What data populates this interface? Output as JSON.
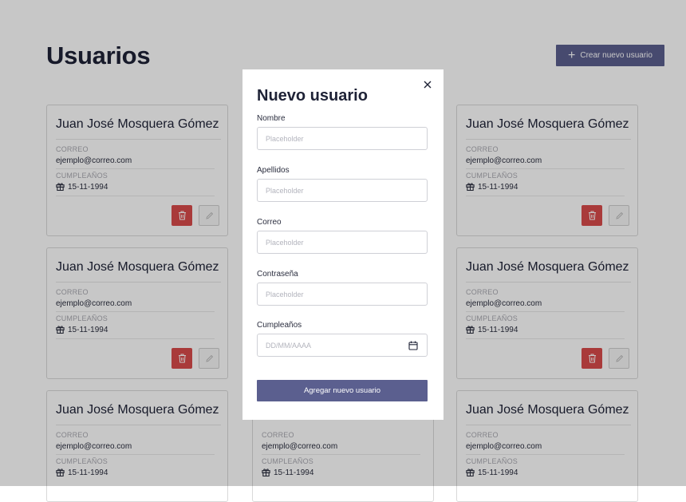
{
  "page": {
    "title": "Usuarios",
    "create_button_label": "Crear nuevo usuario"
  },
  "users": [
    {
      "name": "Juan José Mosquera Gómez",
      "email_label": "CORREO",
      "email": "ejemplo@correo.com",
      "birthday_label": "CUMPLEAÑOS",
      "birthday": "15-11-1994"
    },
    {
      "name": "Juan José Mosquera Gómez",
      "email_label": "CORREO",
      "email": "ejemplo@correo.com",
      "birthday_label": "CUMPLEAÑOS",
      "birthday": "15-11-1994"
    },
    {
      "name": "Juan José Mosquera Gómez",
      "email_label": "CORREO",
      "email": "ejemplo@correo.com",
      "birthday_label": "CUMPLEAÑOS",
      "birthday": "15-11-1994"
    },
    {
      "name": "Juan José Mosquera Gómez",
      "email_label": "CORREO",
      "email": "ejemplo@correo.com",
      "birthday_label": "CUMPLEAÑOS",
      "birthday": "15-11-1994"
    },
    {
      "name": "Juan José Mosquera Gómez",
      "email_label": "CORREO",
      "email": "ejemplo@correo.com",
      "birthday_label": "CUMPLEAÑOS",
      "birthday": "15-11-1994"
    },
    {
      "name": "",
      "email_label": "CORREO",
      "email": "ejemplo@correo.com",
      "birthday_label": "CUMPLEAÑOS",
      "birthday": "15-11-1994"
    },
    {
      "name": "Juan José Mosquera Gómez",
      "email_label": "CORREO",
      "email": "ejemplo@correo.com",
      "birthday_label": "CUMPLEAÑOS",
      "birthday": "15-11-1994"
    }
  ],
  "modal": {
    "title": "Nuevo usuario",
    "fields": [
      {
        "label": "Nombre",
        "placeholder": "Placeholder"
      },
      {
        "label": "Apellidos",
        "placeholder": "Placeholder"
      },
      {
        "label": "Correo",
        "placeholder": "Placeholder"
      },
      {
        "label": "Contraseña",
        "placeholder": "Placeholder"
      },
      {
        "label": "Cumpleaños",
        "placeholder": "DD/MM/AAAA"
      }
    ],
    "submit_label": "Agregar nuevo usuario"
  },
  "icons": {
    "create": "plus-icon",
    "close": "close-icon",
    "delete": "trash-icon",
    "edit": "pencil-icon",
    "birthday": "gift-icon",
    "date": "calendar-icon"
  },
  "colors": {
    "primary": "#5b5f8f",
    "danger": "#d94b4b",
    "title": "#1e2236",
    "overlay": "rgba(0,0,0,0.22)"
  }
}
